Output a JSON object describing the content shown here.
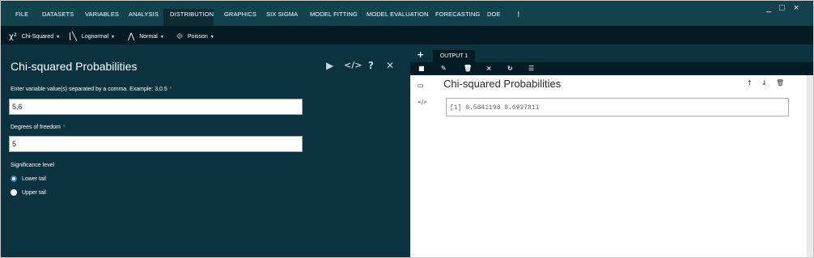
{
  "menu": {
    "items": [
      "FILE",
      "DATASETS",
      "VARIABLES",
      "ANALYSIS",
      "DISTRIBUTION",
      "GRAPHICS",
      "SIX SIGMA",
      "MODEL FITTING",
      "MODEL EVALUATION",
      "FORECASTING",
      "DOE",
      "⋮"
    ],
    "active": "DISTRIBUTION"
  },
  "window_controls": {
    "minimize": "_",
    "maximize": "□",
    "close": "×"
  },
  "submenu": [
    {
      "icon": "χ²",
      "label": "Chi-Squared",
      "caret": "▾"
    },
    {
      "icon": "⌊╲",
      "label": "Lognormal",
      "caret": "▾"
    },
    {
      "icon": "⋀",
      "label": "Normal",
      "caret": "▾"
    },
    {
      "icon": "⟐",
      "label": "Poisson",
      "caret": "▾"
    }
  ],
  "left_panel": {
    "title": "Chi-squared Probabilities",
    "tools": {
      "run": "▶",
      "code": "</>",
      "help": "?",
      "close": "✕"
    },
    "values_label": "Enter variable value(s) separated by a comma. Example: 3,0.5",
    "values_value": "5,6",
    "df_label": "Degrees of freedom",
    "df_value": "5",
    "required_mark": "*",
    "significance_label": "Significance level",
    "radio_lower": "Lower tail",
    "radio_upper": "Upper tail",
    "selected_tail": "Lower tail"
  },
  "output": {
    "add_button": "+",
    "tab_label": "OUTPUT 1",
    "toolbar": {
      "add": "■",
      "edit": "✎",
      "delete": "🗑",
      "close": "×",
      "refresh": "↻",
      "list": "☰"
    },
    "title": "Chi-squared Probabilities",
    "controls": {
      "up": "↑",
      "down": "↓",
      "trash": "🗑"
    },
    "gutter": {
      "block": "▭",
      "code": "</>"
    },
    "result": "[1] 0.5841198 0.6937811"
  }
}
